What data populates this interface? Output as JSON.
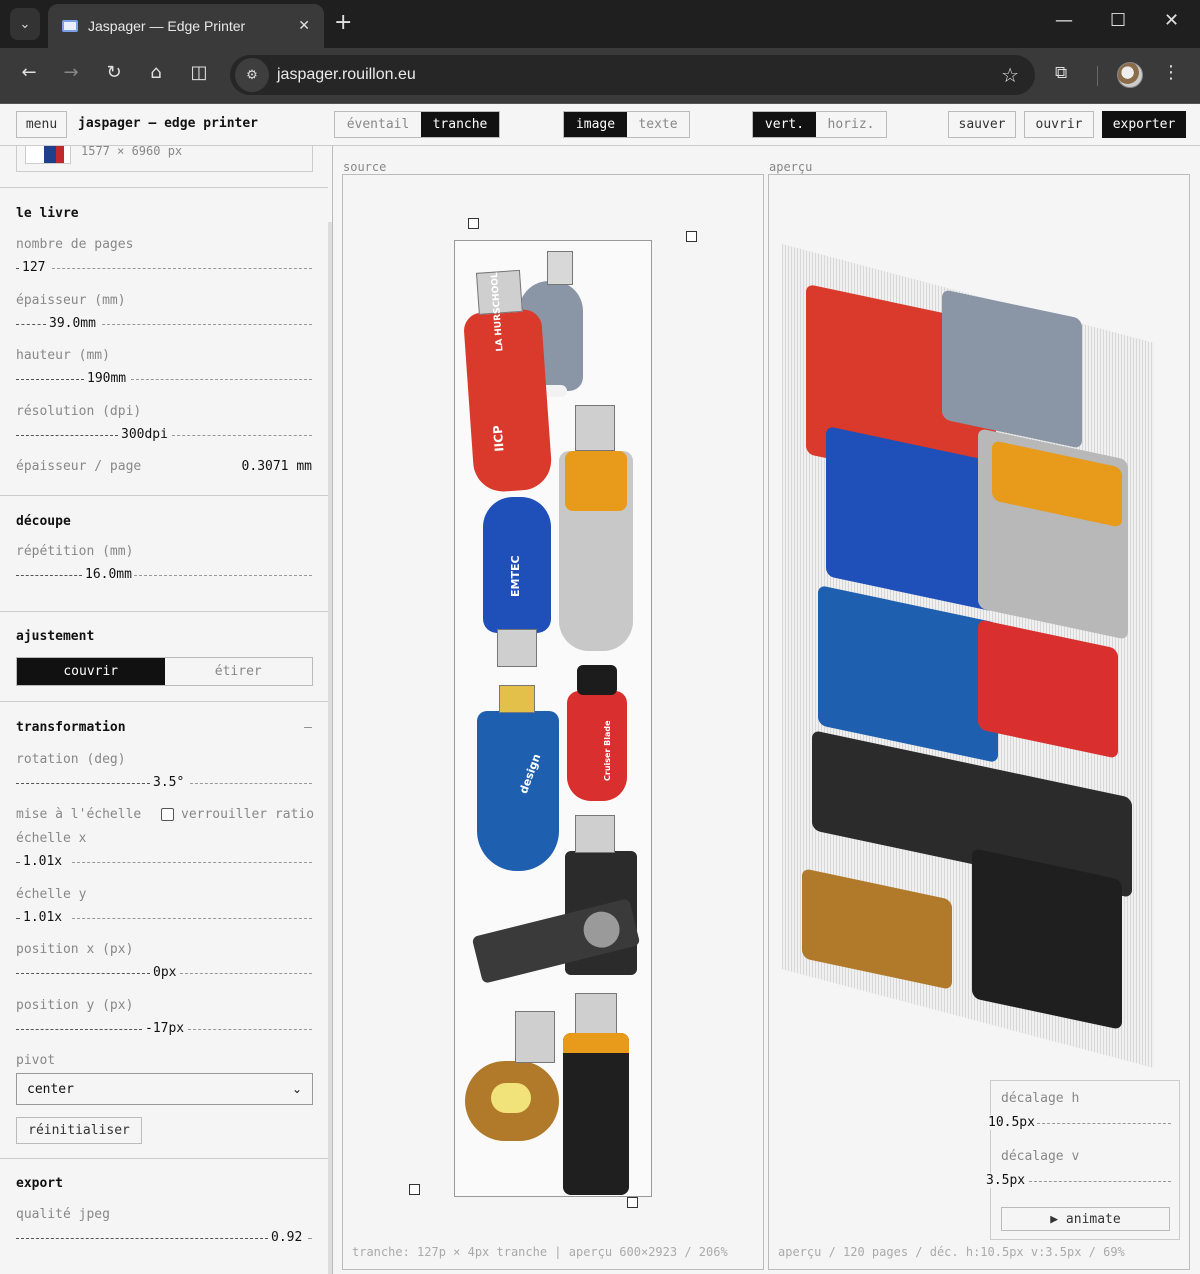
{
  "browser": {
    "tab_title": "Jaspager — Edge Printer",
    "url": "jaspager.rouillon.eu",
    "icons": {
      "tab_list": "chevron-down-icon",
      "favicon": "book-icon",
      "close_tab": "close-icon",
      "new_tab": "plus-icon",
      "minimize": "minimize-icon",
      "maximize": "maximize-icon",
      "close_window": "close-icon",
      "back": "arrow-left-icon",
      "forward": "arrow-right-icon",
      "reload": "reload-icon",
      "home": "home-icon",
      "split": "split-screen-icon",
      "site_info": "site-info-icon",
      "favorite": "star-icon",
      "extensions": "puzzle-icon",
      "profile": "avatar",
      "menu": "more-vertical-icon"
    }
  },
  "header": {
    "menu_label": "menu",
    "app_title": "jaspager — edge printer",
    "mode_tabs": [
      "éventail",
      "tranche"
    ],
    "mode_active": "tranche",
    "content_tabs": [
      "image",
      "texte"
    ],
    "content_active": "image",
    "orient_tabs": [
      "vert.",
      "horiz."
    ],
    "orient_active": "vert.",
    "save_label": "sauver",
    "open_label": "ouvrir",
    "export_label": "exporter"
  },
  "image_info": {
    "dimensions": "1577 × 6960 px"
  },
  "book": {
    "title": "le livre",
    "pages_label": "nombre de pages",
    "pages_value": "127",
    "thickness_label": "épaisseur (mm)",
    "thickness_value": "39.0mm",
    "height_label": "hauteur (mm)",
    "height_value": "190mm",
    "resolution_label": "résolution (dpi)",
    "resolution_value": "300dpi",
    "per_page_label": "épaisseur / page",
    "per_page_value": "0.3071 mm"
  },
  "cut": {
    "title": "découpe",
    "repeat_label": "répétition (mm)",
    "repeat_value": "16.0mm"
  },
  "fit": {
    "title": "ajustement",
    "options": [
      "couvrir",
      "étirer"
    ],
    "active": "couvrir"
  },
  "transform": {
    "title": "transformation",
    "collapse": "–",
    "rotation_label": "rotation (deg)",
    "rotation_value": "3.5°",
    "scale_label": "mise à l'échelle",
    "lock_ratio_label": "verrouiller ratio",
    "lock_ratio_checked": false,
    "scale_x_label": "échelle x",
    "scale_x_value": "1.01x",
    "scale_y_label": "échelle y",
    "scale_y_value": "1.01x",
    "pos_x_label": "position x (px)",
    "pos_x_value": "0px",
    "pos_y_label": "position y (px)",
    "pos_y_value": "-17px",
    "pivot_label": "pivot",
    "pivot_value": "center",
    "reset_label": "réinitialiser"
  },
  "export": {
    "title": "export",
    "quality_label": "qualité jpeg",
    "quality_value": "0.92"
  },
  "source_panel": {
    "label": "source",
    "footer": "tranche: 127p × 4px tranche | aperçu 600×2923 / 206%"
  },
  "preview_panel": {
    "label": "aperçu",
    "footer": "aperçu / 120 pages / déc. h:10.5px v:3.5px / 69%",
    "offset_h_label": "décalage h",
    "offset_h_value": "10.5px",
    "offset_v_label": "décalage v",
    "offset_v_value": "3.5px",
    "animate_label": "▶ animate"
  },
  "drive_labels": {
    "red_brand": "LA HURSCHOOL",
    "red_logo": "IICP",
    "blue_brand": "EMTEC",
    "key_brand": "design",
    "red_small": "Cruiser Blade"
  },
  "colors": {
    "accent": "#111111",
    "drive_red": "#d93a2b",
    "drive_blue": "#1f4fb8",
    "drive_orange": "#e89a1a",
    "drive_black": "#2b2b2b"
  }
}
